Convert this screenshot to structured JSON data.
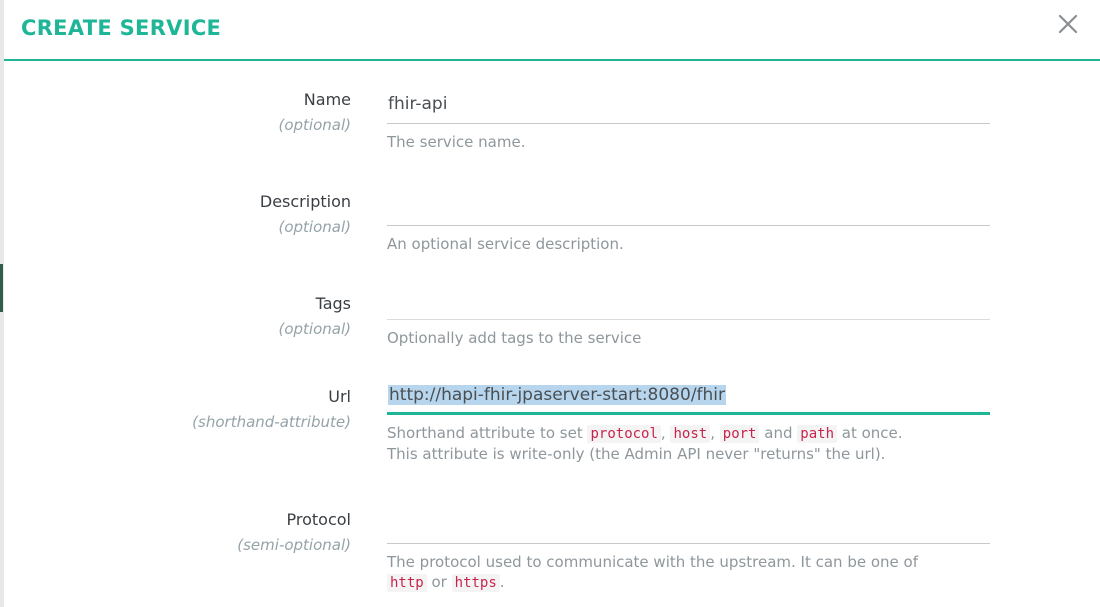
{
  "modal": {
    "title": "CREATE SERVICE",
    "accent_color": "#1fb597",
    "close_icon": "close-icon"
  },
  "fields": {
    "name": {
      "label": "Name",
      "sub": "(optional)",
      "value": "fhir-api",
      "help": "The service name."
    },
    "description": {
      "label": "Description",
      "sub": "(optional)",
      "value": "",
      "help": "An optional service description."
    },
    "tags": {
      "label": "Tags",
      "sub": "(optional)",
      "value": "",
      "help": "Optionally add tags to the service"
    },
    "url": {
      "label": "Url",
      "sub": "(shorthand-attribute)",
      "value": "http://hapi-fhir-jpaserver-start:8080/fhir",
      "help_prefix": "Shorthand attribute to set",
      "help_code_1": "protocol",
      "help_sep_1": ",",
      "help_code_2": "host",
      "help_sep_2": ",",
      "help_code_3": "port",
      "help_and": "and",
      "help_code_4": "path",
      "help_suffix": "at once.",
      "help_line2": "This attribute is write-only (the Admin API never \"returns\" the url)."
    },
    "protocol": {
      "label": "Protocol",
      "sub": "(semi-optional)",
      "value": "",
      "help_prefix": "The protocol used to communicate with the upstream. It can be one of",
      "help_code_1": "http",
      "help_or": "or",
      "help_code_2": "https",
      "help_suffix": "."
    }
  }
}
